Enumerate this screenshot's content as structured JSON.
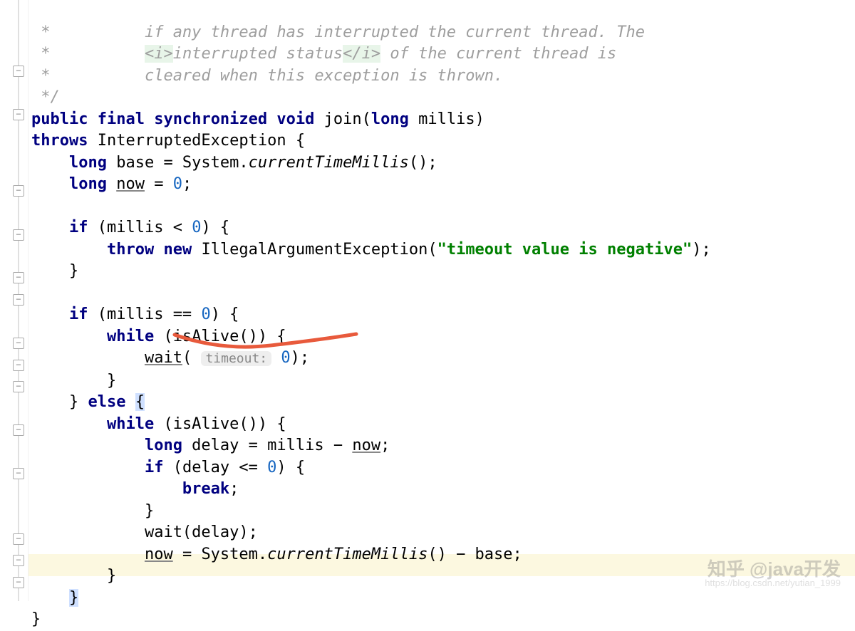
{
  "comment": {
    "line1_pre": " *          ",
    "line1_text": "if any thread has interrupted the current thread. The",
    "line2_pre": " *          ",
    "line2_open": "<i>",
    "line2_mid": "interrupted status",
    "line2_close": "</i>",
    "line2_rest": " of the current thread is",
    "line3_pre": " *          ",
    "line3_text": "cleared when this exception is thrown.",
    "line4": " */"
  },
  "sig": {
    "public": "public",
    "final": "final",
    "synchronized": "synchronized",
    "void": "void",
    "join": "join",
    "lp": "(",
    "long": "long",
    "millis": "millis",
    "rp": ")"
  },
  "throws": {
    "kw": "throws",
    "exc": "InterruptedException",
    "br": " {"
  },
  "l_base": {
    "long": "long",
    "base": " base = System.",
    "ctm": "currentTimeMillis",
    "end": "();"
  },
  "l_now": {
    "long": "long",
    "now": "now",
    "eq": " = ",
    "zero": "0",
    "semi": ";"
  },
  "if_neg": {
    "if": "if",
    "cond": " (millis < ",
    "zero": "0",
    "rest": ") {"
  },
  "throw_line": {
    "throw": "throw",
    "new": "new",
    "exc": " IllegalArgumentException(",
    "str": "\"timeout value is negative\"",
    "end": ");"
  },
  "brace_close": "}",
  "if_zero": {
    "if": "if",
    "cond": " (millis == ",
    "zero": "0",
    "rest": ") {"
  },
  "while_alive": {
    "while": "while",
    "rest": " (isAlive()) {"
  },
  "wait0": {
    "wait": "wait",
    "lp": "(",
    "hint": "timeout:",
    "sp": " ",
    "zero": "0",
    "end": ");"
  },
  "else_kw": "else",
  "delay": {
    "long": "long",
    "txt": " delay = millis − ",
    "now": "now",
    "semi": ";"
  },
  "if_delay": {
    "if": "if",
    "rest": " (delay <= ",
    "zero": "0",
    "end": ") {"
  },
  "break": {
    "kw": "break",
    "semi": ";"
  },
  "wait_delay": "wait(delay);",
  "now_assign": {
    "now": "now",
    "eq": " = System.",
    "ctm": "currentTimeMillis",
    "end": "() − base;"
  },
  "watermark": "知乎 @java开发",
  "watermark_sub": "https://blog.csdn.net/yutian_1999"
}
